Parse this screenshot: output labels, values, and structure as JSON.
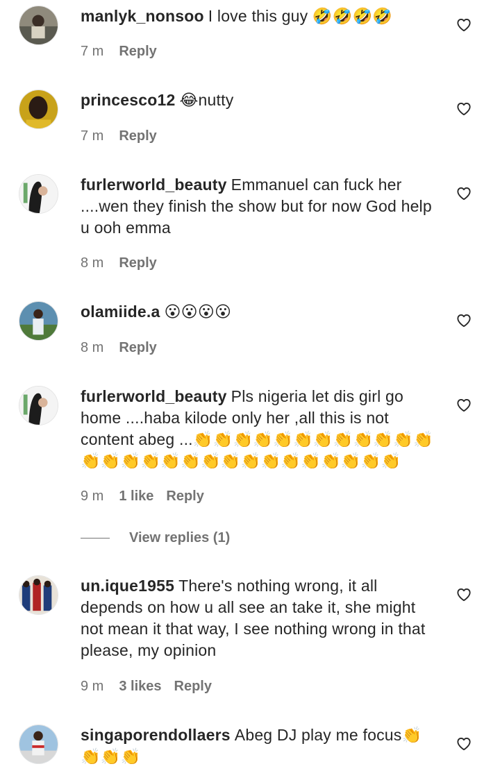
{
  "comments": [
    {
      "username": "manlyk_nonsoo",
      "text": "I love this guy 🤣🤣🤣🤣",
      "time": "7 m",
      "likes": "",
      "reply": "Reply",
      "avatar_colors": [
        "#5a5a50",
        "#8f8a7c"
      ]
    },
    {
      "username": "princesco12",
      "text": "😂nutty",
      "time": "7 m",
      "likes": "",
      "reply": "Reply",
      "avatar_colors": [
        "#c8a21a",
        "#2a1b14"
      ]
    },
    {
      "username": "furlerworld_beauty",
      "text": "Emmanuel can fuck her ....wen they finish the show but for now God help u ooh emma",
      "time": "8 m",
      "likes": "",
      "reply": "Reply",
      "avatar_colors": [
        "#f4f4f4",
        "#1c1c1c"
      ]
    },
    {
      "username": "olamiide.a",
      "text": "😮😮😮😮",
      "time": "8 m",
      "likes": "",
      "reply": "Reply",
      "avatar_colors": [
        "#5d8fb0",
        "#e9eef2"
      ]
    },
    {
      "username": "furlerworld_beauty",
      "text": "Pls nigeria let dis girl go home ....haba kilode only her ,all this is not content abeg ...👏👏👏👏👏👏👏👏👏👏👏👏👏👏👏👏👏👏👏👏👏👏👏👏👏👏👏👏",
      "time": "9 m",
      "likes": "1 like",
      "reply": "Reply",
      "view_replies": "View replies (1)",
      "avatar_colors": [
        "#f4f4f4",
        "#1c1c1c"
      ]
    },
    {
      "username": "un.ique1955",
      "text": "There's nothing wrong, it all depends on how u all see an take it, she might not mean it that way, I see nothing wrong in that please, my opinion",
      "time": "9 m",
      "likes": "3 likes",
      "reply": "Reply",
      "avatar_colors": [
        "#1f3d7a",
        "#b02424"
      ]
    },
    {
      "username": "singaporendollaers",
      "text": "Abeg DJ play me focus👏👏👏👏",
      "time": "",
      "likes": "",
      "reply": "",
      "avatar_colors": [
        "#9fc3e0",
        "#c92b2b"
      ]
    }
  ],
  "icons": {
    "like": "heart-outline-icon"
  },
  "colors": {
    "text": "#262626",
    "secondary": "#737373",
    "background": "#ffffff"
  }
}
